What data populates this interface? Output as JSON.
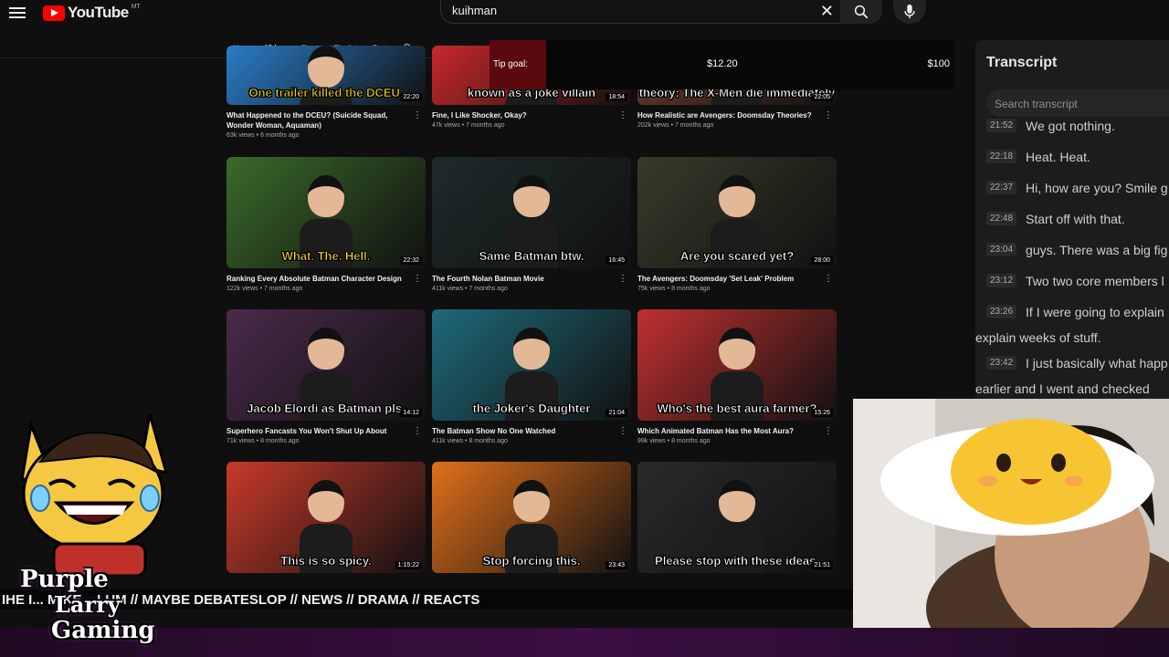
{
  "topbar": {
    "logo_text": "YouTube",
    "logo_superscript": "MT",
    "search_value": "kuihman"
  },
  "channel_tabs": [
    {
      "label": "Home",
      "active": false
    },
    {
      "label": "Videos",
      "active": true
    },
    {
      "label": "Shorts",
      "active": false
    },
    {
      "label": "Playlists",
      "active": false
    },
    {
      "label": "Posts",
      "active": false
    }
  ],
  "tip_goal": {
    "label": "Tip goal:",
    "current": "$12.20",
    "target": "$100",
    "progress_fraction": 0.122
  },
  "videos": [
    {
      "title": "What Happened to the DCEU? (Suicide Squad, Wonder Woman, Aquaman)",
      "meta": "63k views • 6 months ago",
      "caption": "One trailer killed the DCEU.",
      "duration": "22:20",
      "bg": "#2b7cc8",
      "accent": "#f2d200"
    },
    {
      "title": "Fine, I Like Shocker, Okay?",
      "meta": "47k views • 7 months ago",
      "caption": "known as a joke villain",
      "duration": "18:54",
      "bg": "#c8282a",
      "accent": "#ffffff"
    },
    {
      "title": "How Realistic are Avengers: Doomsday Theories?",
      "meta": "202k views • 7 months ago",
      "caption": "theory: The X-Men die immediately",
      "duration": "22:05",
      "bg": "#6a3b2a",
      "accent": "#ffffff"
    },
    {
      "title": "Ranking Every Absolute Batman Character Design",
      "meta": "122k views • 7 months ago",
      "caption": "What. The. Hell.",
      "duration": "22:32",
      "bg": "#3a6a2a",
      "accent": "#ffdf20"
    },
    {
      "title": "The Fourth Nolan Batman Movie",
      "meta": "411k views • 7 months ago",
      "caption": "Same Batman btw.",
      "duration": "16:45",
      "bg": "#1e2a2a",
      "accent": "#ffffff"
    },
    {
      "title": "The Avengers: Doomsday 'Set Leak' Problem",
      "meta": "75k views • 8 months ago",
      "caption": "Are you scared yet?",
      "duration": "28:00",
      "bg": "#3a3a2a",
      "accent": "#ffffff"
    },
    {
      "title": "Superhero Fancasts You Won't Shut Up About",
      "meta": "71k views • 8 months ago",
      "caption": "Jacob Elordi as Batman pls.",
      "duration": "14:12",
      "bg": "#4a2a4a",
      "accent": "#ffffff"
    },
    {
      "title": "The Batman Show No One Watched",
      "meta": "411k views • 8 months ago",
      "caption": "the Joker's Daughter",
      "duration": "21:04",
      "bg": "#1e6a7a",
      "accent": "#ffffff"
    },
    {
      "title": "Which Animated Batman Has the Most Aura?",
      "meta": "99k views • 8 months ago",
      "caption": "Who's the best aura farmer?",
      "duration": "15:26",
      "bg": "#c03030",
      "accent": "#ffffff"
    },
    {
      "title": "",
      "meta": "",
      "caption": "This is so spicy.",
      "duration": "1:15:22",
      "bg": "#c83a2a",
      "accent": "#ffffff"
    },
    {
      "title": "",
      "meta": "",
      "caption": "Stop forcing this.",
      "duration": "23:43",
      "bg": "#e0701a",
      "accent": "#ffffff"
    },
    {
      "title": "",
      "meta": "",
      "caption": "Please stop with these ideas.",
      "duration": "21:51",
      "bg": "#2a2a2a",
      "accent": "#ffffff"
    }
  ],
  "transcript": {
    "title": "Transcript",
    "search_placeholder": "Search transcript",
    "lines": [
      {
        "time": "21:52",
        "text": "We got nothing."
      },
      {
        "time": "22:18",
        "text": "Heat. Heat."
      },
      {
        "time": "22:37",
        "text": "Hi, how are you? Smile g"
      },
      {
        "time": "22:48",
        "text": "Start off with that."
      },
      {
        "time": "23:04",
        "text": "guys. There was a big fig"
      },
      {
        "time": "23:12",
        "text": "Two two core members l"
      },
      {
        "time": "23:26",
        "text": "If I were going to explain",
        "text2": "explain weeks of stuff."
      },
      {
        "time": "23:42",
        "text": "I just basically what happ",
        "text2": "earlier and I went and checked"
      }
    ]
  },
  "ticker": {
    "text": "IHE I... MIKE ...LUM // MAYBE DEBATESLOP // NEWS // DRAMA // REACTS"
  },
  "stream_logo": {
    "line1": "Purple",
    "line2": "Larry",
    "line3": "Gaming"
  },
  "colors": {
    "bg": "#0f0f0f",
    "yt_red": "#ff0000",
    "tip_fill": "#5a0a0f",
    "band_purple": "#3b0f42"
  }
}
